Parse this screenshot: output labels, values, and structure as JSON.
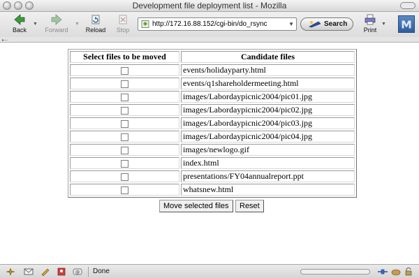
{
  "window": {
    "title": "Development file deployment list - Mozilla"
  },
  "toolbar": {
    "back_label": "Back",
    "forward_label": "Forward",
    "reload_label": "Reload",
    "stop_label": "Stop",
    "print_label": "Print",
    "search_label": "Search",
    "url": "http://172.16.88.152/cgi-bin/do_rsync"
  },
  "table": {
    "headers": [
      "Select files to be moved",
      "Candidate files"
    ],
    "rows": [
      {
        "checked": false,
        "file": "events/holidayparty.html"
      },
      {
        "checked": false,
        "file": "events/q1shareholdermeeting.html"
      },
      {
        "checked": false,
        "file": "images/Labordaypicnic2004/pic01.jpg"
      },
      {
        "checked": false,
        "file": "images/Labordaypicnic2004/pic02.jpg"
      },
      {
        "checked": false,
        "file": "images/Labordaypicnic2004/pic03.jpg"
      },
      {
        "checked": false,
        "file": "images/Labordaypicnic2004/pic04.jpg"
      },
      {
        "checked": false,
        "file": "images/newlogo.gif"
      },
      {
        "checked": false,
        "file": "index.html"
      },
      {
        "checked": false,
        "file": "presentations/FY04annualreport.ppt"
      },
      {
        "checked": false,
        "file": "whatsnew.html"
      }
    ]
  },
  "form": {
    "submit_label": "Move selected files",
    "reset_label": "Reset"
  },
  "status": {
    "text": "Done"
  }
}
